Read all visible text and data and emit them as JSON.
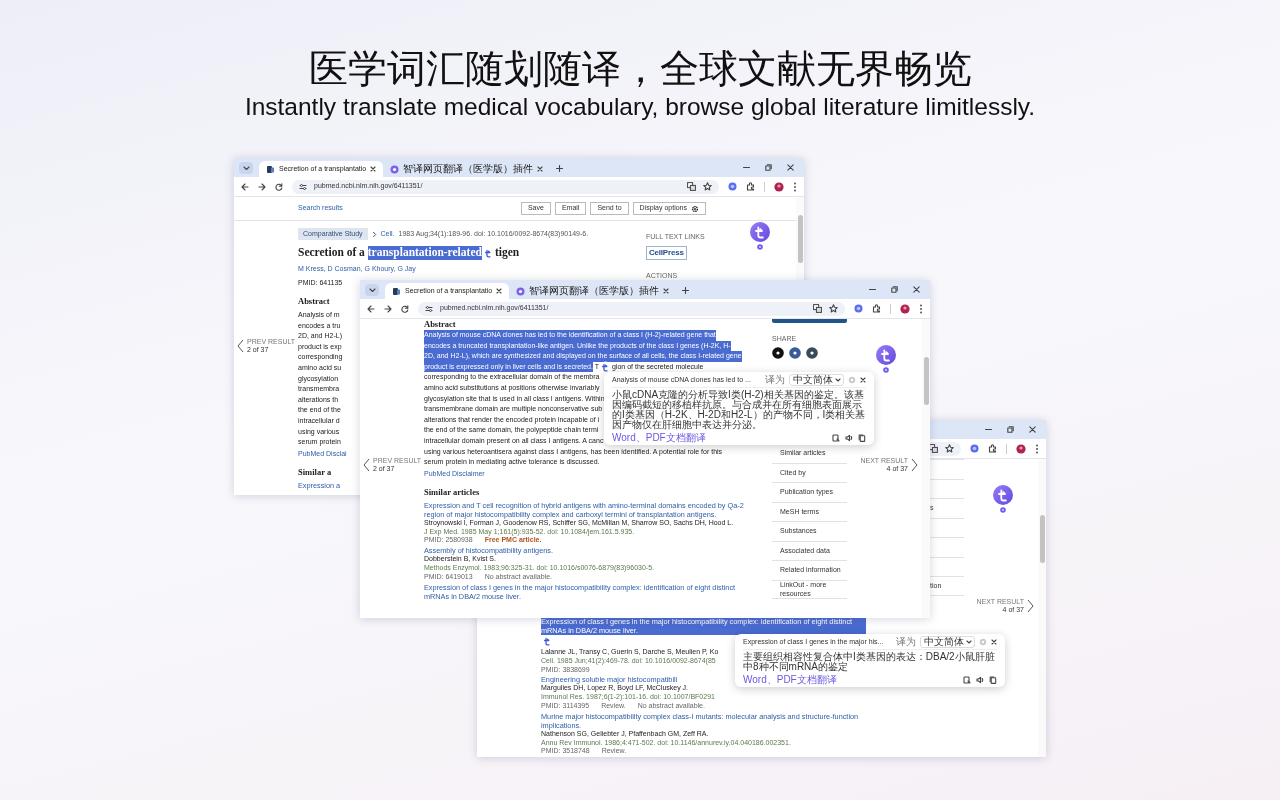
{
  "headline": {
    "title": "医学词汇随划随译，全球文献无界畅览",
    "subtitle": "Instantly translate medical vocabulary, browse global literature limitlessly."
  },
  "windows": [
    {
      "tabs": [
        {
          "label": "Secretion of a transplantatio",
          "selected": true
        },
        {
          "label": "智译网页翻译（医学版）插件",
          "selected": false
        }
      ],
      "url": "pubmed.ncbi.nlm.nih.gov/6411351/",
      "page_bar": {
        "back_link": "Search results",
        "buttons": [
          "Save",
          "Email",
          "Send to",
          "Display options"
        ]
      },
      "main": [
        {
          "kind": "citation",
          "badge": "Comparative Study",
          "journal": "Cell.",
          "details": "1983 Aug;34(1):189-96. doi: 10.1016/0092-8674(83)90149-6."
        },
        {
          "kind": "title",
          "segments": [
            {
              "kind": "text",
              "text": "Secretion of a ",
              "selected": false
            },
            {
              "kind": "text",
              "text": "transplantation-related",
              "selected": true
            },
            {
              "kind": "marker"
            },
            {
              "kind": "text",
              "text": "tigen",
              "selected": false
            }
          ]
        },
        {
          "kind": "authors",
          "text": "M Kress, D Cosman, G Khoury, G Jay"
        },
        {
          "kind": "pmid",
          "text": "PMID: 641135"
        },
        {
          "kind": "heading",
          "text": "Abstract"
        },
        {
          "kind": "lines",
          "lines": [
            {
              "segments": [
                {
                  "kind": "text",
                  "text": "Analysis of m",
                  "selected": false
                }
              ]
            },
            {
              "segments": [
                {
                  "kind": "text",
                  "text": "encodes a tru",
                  "selected": false
                }
              ]
            },
            {
              "segments": [
                {
                  "kind": "text",
                  "text": "2D, and H2-L)",
                  "selected": false
                }
              ]
            },
            {
              "segments": [
                {
                  "kind": "text",
                  "text": "product is exp",
                  "selected": false
                }
              ]
            },
            {
              "segments": [
                {
                  "kind": "text",
                  "text": "corresponding",
                  "selected": false
                }
              ]
            },
            {
              "segments": [
                {
                  "kind": "text",
                  "text": "amino acid su",
                  "selected": false
                }
              ]
            },
            {
              "segments": [
                {
                  "kind": "text",
                  "text": "glycosylation",
                  "selected": false
                }
              ]
            },
            {
              "segments": [
                {
                  "kind": "text",
                  "text": "transmembra",
                  "selected": false
                }
              ]
            },
            {
              "segments": [
                {
                  "kind": "text",
                  "text": "alterations th",
                  "selected": false
                }
              ]
            },
            {
              "segments": [
                {
                  "kind": "text",
                  "text": "the end of the",
                  "selected": false
                }
              ]
            },
            {
              "segments": [
                {
                  "kind": "text",
                  "text": "intracellular d",
                  "selected": false
                }
              ]
            },
            {
              "segments": [
                {
                  "kind": "text",
                  "text": "using various",
                  "selected": false
                }
              ]
            },
            {
              "segments": [
                {
                  "kind": "text",
                  "text": "serum protein",
                  "selected": false
                }
              ]
            }
          ]
        },
        {
          "kind": "disclaimer",
          "text": "PubMed Disclai"
        },
        {
          "kind": "heading",
          "text": "Similar a"
        },
        {
          "kind": "article",
          "title": [
            {
              "kind": "text",
              "text": "Expression a",
              "selected": false
            }
          ]
        }
      ],
      "sidebar": [
        {
          "kind": "label",
          "text": "FULL TEXT LINKS"
        },
        {
          "kind": "publisher",
          "text": "CellPress"
        },
        {
          "kind": "label",
          "text": "ACTIONS"
        }
      ],
      "prev": {
        "label": "PREV RESULT",
        "count": "2 of 37"
      }
    },
    {
      "tabs": [
        {
          "label": "Secretion of a transplantatio",
          "selected": true
        },
        {
          "label": "智译网页翻译（医学版）插件",
          "selected": false
        }
      ],
      "url": "pubmed.ncbi.nlm.nih.gov/6411351/",
      "main": [
        {
          "kind": "heading",
          "text": "Abstract"
        },
        {
          "kind": "lines",
          "lines": [
            {
              "segments": [
                {
                  "kind": "text",
                  "text": "Analysis of mouse cDNA clones has led to the identification of a class I (H-2)-related gene that",
                  "selected": true
                }
              ]
            },
            {
              "segments": [
                {
                  "kind": "text",
                  "text": "encodes a truncated transplantation-like antigen. Unlike the products of the class I genes (H-2K, H-",
                  "selected": true
                }
              ]
            },
            {
              "segments": [
                {
                  "kind": "text",
                  "text": "2D, and H2-L), which are synthesized and displayed on the surface of all cells, the class I-related gene",
                  "selected": true
                }
              ]
            },
            {
              "segments": [
                {
                  "kind": "text",
                  "text": "product is expressed only in liver cells and is secreted.",
                  "selected": true
                },
                {
                  "kind": "text",
                  "text": " T",
                  "selected": false
                },
                {
                  "kind": "marker"
                },
                {
                  "kind": "text",
                  "text": "gion of the secreted molecule",
                  "selected": false
                }
              ]
            },
            {
              "segments": [
                {
                  "kind": "text",
                  "text": "corresponding to the extracellular domain of the membra",
                  "selected": false
                }
              ]
            },
            {
              "segments": [
                {
                  "kind": "text",
                  "text": "amino acid substitutions at positions otherwise invariably",
                  "selected": false
                }
              ]
            },
            {
              "segments": [
                {
                  "kind": "text",
                  "text": "glycosylation site that is used in all class I antigens. Within",
                  "selected": false
                }
              ]
            },
            {
              "segments": [
                {
                  "kind": "text",
                  "text": "transmembrane domain are multiple nonconservative sub",
                  "selected": false
                }
              ]
            },
            {
              "segments": [
                {
                  "kind": "text",
                  "text": "alterations that render the encoded protein incapable of i",
                  "selected": false
                }
              ]
            },
            {
              "segments": [
                {
                  "kind": "text",
                  "text": "the end of the same domain, the polypeptide chain termi",
                  "selected": false
                }
              ]
            },
            {
              "segments": [
                {
                  "kind": "text",
                  "text": "intracellular domain present on all class I antigens. A canc",
                  "selected": false
                }
              ]
            },
            {
              "segments": [
                {
                  "kind": "text",
                  "text": "using various heteroantisera against class I antigens, has been identified. A potential role for this",
                  "selected": false
                }
              ]
            },
            {
              "segments": [
                {
                  "kind": "text",
                  "text": "serum protein in mediating active tolerance is discussed.",
                  "selected": false
                }
              ]
            }
          ]
        },
        {
          "kind": "disclaimer",
          "text": "PubMed Disclaimer"
        },
        {
          "kind": "heading",
          "text": "Similar articles"
        },
        {
          "kind": "article",
          "title": [
            {
              "kind": "text",
              "text": "Expression and T cell recognition of hybrid antigens with amino-terminal domains encoded by Qa-2 region of major histocompatibility complex and carboxyl termini of transplantation antigens.",
              "selected": false
            }
          ],
          "authors": "Stroynowski I, Forman J, Goodenow RS, Schiffer SG, McMillan M, Sharrow SO, Sachs DH, Hood L.",
          "citation": "J Exp Med. 1985 May 1;161(5):935-52. doi: 10.1084/jem.161.5.935.",
          "pmid": "PMID: 2580938",
          "notes": [
            {
              "kind": "free",
              "text": "Free PMC article."
            }
          ]
        },
        {
          "kind": "article",
          "title": [
            {
              "kind": "text",
              "text": "Assembly of histocompatibility antigens.",
              "selected": false
            }
          ],
          "authors": "Dobberstein B, Kvist S.",
          "citation": "Methods Enzymol. 1983;96:325-31. doi: 10.1016/s0076-6879(83)96030-5.",
          "pmid": "PMID: 6419013",
          "notes": [
            {
              "kind": "info",
              "text": "No abstract available."
            }
          ]
        },
        {
          "kind": "article",
          "title": [
            {
              "kind": "text",
              "text": "Expression of class I genes in the major histocompatibility complex: identification of eight distinct mRNAs in DBA/2 mouse liver.",
              "selected": false
            }
          ]
        }
      ],
      "sidebar": [
        {
          "kind": "bar"
        },
        {
          "kind": "label",
          "text": "SHARE"
        },
        {
          "kind": "share"
        },
        {
          "kind": "nav",
          "text": "Similar articles"
        },
        {
          "kind": "nav",
          "text": "Cited by"
        },
        {
          "kind": "nav",
          "text": "Publication types"
        },
        {
          "kind": "nav",
          "text": "MeSH terms"
        },
        {
          "kind": "nav",
          "text": "Substances"
        },
        {
          "kind": "nav",
          "text": "Associated data"
        },
        {
          "kind": "nav",
          "text": "Related information"
        },
        {
          "kind": "nav",
          "text": "LinkOut - more resources"
        }
      ],
      "prev": {
        "label": "PREV RESULT",
        "count": "2 of 37"
      },
      "next": {
        "label": "NEXT RESULT",
        "count": "4 of 37"
      },
      "popup": {
        "source": "Analysis of mouse cDNA clones has led to ...",
        "target_label": "译为",
        "language": "中文简体",
        "translation": "小鼠cDNA克隆的分析导致I类(H-2)相关基因的鉴定。该基因编码截短的移植样抗原。与合成并在所有细胞表面展示的I类基因（H-2K、H-2D和H2-L）的产物不同，I类相关基因产物仅在肝细胞中表达并分泌。",
        "link": "Word、PDF文档翻译"
      }
    },
    {
      "main": [
        {
          "kind": "article",
          "title": [
            {
              "kind": "text",
              "text": "Expression of class I genes in the major histocompatibility complex: identification of eight distinct mRNAs in DBA/2 mouse liver.",
              "selected": true
            },
            {
              "kind": "marker"
            }
          ],
          "authors": "Lalanne JL, Transy C, Guerin S, Darche S, Meulien P, Ko",
          "citation": "Cell. 1985 Jun;41(2):469-78. doi: 10.1016/0092-8674(85",
          "pmid": "PMID: 3838699"
        },
        {
          "kind": "article",
          "title": [
            {
              "kind": "text",
              "text": "Engineering soluble major histocompatibili",
              "selected": false
            }
          ],
          "authors": "Margulies DH, Lopez R, Boyd LF, McCluskey J.",
          "citation": "Immunol Res. 1987;6(1-2):101-16. doi: 10.1007/BF0291",
          "pmid": "PMID: 3114395",
          "notes": [
            {
              "kind": "info",
              "text": "Review."
            },
            {
              "kind": "info",
              "text": "No abstract available."
            }
          ]
        },
        {
          "kind": "article",
          "title": [
            {
              "kind": "text",
              "text": "Murine major histocompatibility complex class-I mutants: molecular analysis and structure-function implications.",
              "selected": false
            }
          ],
          "authors": "Nathenson SG, Geliebter J, Pfaffenbach GM, Zeff RA.",
          "citation": "Annu Rev Immunol. 1986;4:471-502. doi: 10.1146/annurev.iy.04.040186.002351.",
          "pmid": "PMID: 3518748",
          "notes": [
            {
              "kind": "info",
              "text": "Review."
            }
          ]
        }
      ],
      "sidebar": [
        {
          "kind": "nav"
        },
        {
          "kind": "nav"
        },
        {
          "kind": "nav",
          "text": "s"
        },
        {
          "kind": "nav"
        },
        {
          "kind": "nav"
        },
        {
          "kind": "nav"
        },
        {
          "kind": "nav",
          "text": "tion"
        }
      ],
      "next": {
        "label": "NEXT RESULT",
        "count": "4 of 37"
      },
      "popup": {
        "source": "Expression of class I genes in the major his...",
        "target_label": "译为",
        "language": "中文简体",
        "translation": "主要组织相容性复合体中I类基因的表达：DBA/2小鼠肝脏中8种不同mRNA的鉴定",
        "link": "Word、PDF文档翻译"
      }
    }
  ]
}
